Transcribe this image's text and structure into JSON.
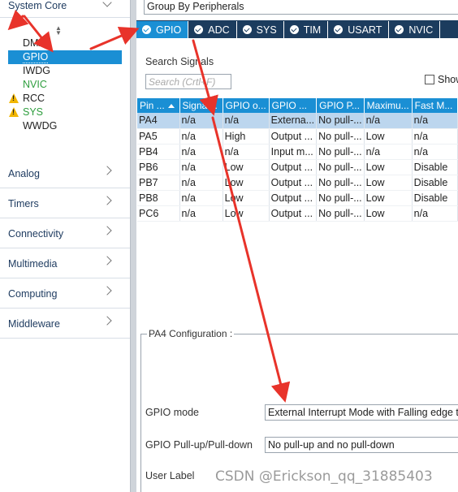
{
  "sidebar": {
    "top_category": "System Core",
    "system_core_items": [
      {
        "label": "DMA",
        "color": "#222222",
        "warning": false
      },
      {
        "label": "GPIO",
        "color": "#ffffff",
        "warning": false,
        "selected": true
      },
      {
        "label": "IWDG",
        "color": "#222222",
        "warning": false
      },
      {
        "label": "NVIC",
        "color": "#2e9e3e",
        "warning": false
      },
      {
        "label": "RCC",
        "color": "#222222",
        "warning": true
      },
      {
        "label": "SYS",
        "color": "#2e9e3e",
        "warning": true
      },
      {
        "label": "WWDG",
        "color": "#222222",
        "warning": false
      }
    ],
    "categories": [
      "Analog",
      "Timers",
      "Connectivity",
      "Multimedia",
      "Computing",
      "Middleware"
    ]
  },
  "main": {
    "group_by": "Group By Peripherals",
    "tabs": [
      "GPIO",
      "ADC",
      "SYS",
      "TIM",
      "USART",
      "NVIC"
    ],
    "search_label": "Search Signals",
    "search_placeholder": "Search (Crtl+F)",
    "show_label": "Show",
    "table": {
      "columns": [
        "Pin ...",
        "Signal...",
        "GPIO o...",
        "GPIO ...",
        "GPIO P...",
        "Maximu...",
        "Fast M..."
      ],
      "rows": [
        [
          "PA4",
          "n/a",
          "n/a",
          "Externa...",
          "No pull-...",
          "n/a",
          "n/a"
        ],
        [
          "PA5",
          "n/a",
          "High",
          "Output ...",
          "No pull-...",
          "Low",
          "n/a"
        ],
        [
          "PB4",
          "n/a",
          "n/a",
          "Input m...",
          "No pull-...",
          "n/a",
          "n/a"
        ],
        [
          "PB6",
          "n/a",
          "Low",
          "Output ...",
          "No pull-...",
          "Low",
          "Disable"
        ],
        [
          "PB7",
          "n/a",
          "Low",
          "Output ...",
          "No pull-...",
          "Low",
          "Disable"
        ],
        [
          "PB8",
          "n/a",
          "Low",
          "Output ...",
          "No pull-...",
          "Low",
          "Disable"
        ],
        [
          "PC6",
          "n/a",
          "Low",
          "Output ...",
          "No pull-...",
          "Low",
          "n/a"
        ]
      ]
    },
    "config": {
      "title": "PA4 Configuration :",
      "gpio_mode_label": "GPIO mode",
      "gpio_mode_value": "External Interrupt Mode with Falling edge trigger detection",
      "pull_label": "GPIO Pull-up/Pull-down",
      "pull_value": "No pull-up and no pull-down",
      "user_label_label": "User Label"
    }
  },
  "watermark": "CSDN @Erickson_qq_31885403",
  "colors": {
    "accent": "#1a8fd4",
    "tabbar": "#1c3c5e",
    "annotation_arrow": "#e8332a",
    "nvic_green": "#2e9e3e",
    "warning": "#f2b600"
  }
}
